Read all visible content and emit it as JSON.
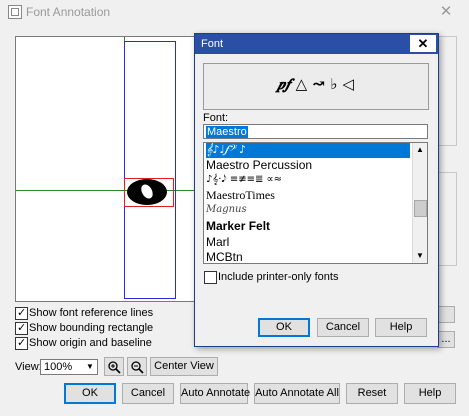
{
  "outer": {
    "title": "Font Annotation",
    "checkboxes": [
      {
        "label": "Show font reference lines",
        "checked": true
      },
      {
        "label": "Show bounding rectangle",
        "checked": true
      },
      {
        "label": "Show origin and baseline",
        "checked": true
      }
    ],
    "view_label": "View:",
    "zoom_value": "100%",
    "zoom_in_icon": "zoom-in",
    "zoom_out_icon": "zoom-out",
    "center_view": "Center View",
    "right_partial_button": "...",
    "buttons": {
      "ok": "OK",
      "cancel": "Cancel",
      "auto_annotate": "Auto Annotate",
      "auto_annotate_all": "Auto Annotate All",
      "reset": "Reset",
      "help": "Help"
    },
    "preview_glyph": "o"
  },
  "font_dialog": {
    "title": "Font",
    "close": "✕",
    "preview_text": "𝆏𝆑 △ ↝ ♭ ◁",
    "font_label": "Font:",
    "font_value": "Maestro",
    "fonts": [
      {
        "name": "𝄞♪♩𝆑𝄢 ♪",
        "selected": true,
        "style": "symbol"
      },
      {
        "name": "Maestro Percussion",
        "selected": false,
        "style": "normal"
      },
      {
        "name": "♪𝄞·𝅘𝅥𝅮 ≡≢≡≣ ∝≈",
        "selected": false,
        "style": "symbol"
      },
      {
        "name": "MaestroTimes",
        "selected": false,
        "style": "serif"
      },
      {
        "name": "Magnus",
        "selected": false,
        "style": "script"
      },
      {
        "name": "Marker Felt",
        "selected": false,
        "style": "bold"
      },
      {
        "name": "Marl",
        "selected": false,
        "style": "normal"
      },
      {
        "name": "MCBtn",
        "selected": false,
        "style": "normal"
      }
    ],
    "include_printer_only": {
      "label": "Include printer-only fonts",
      "checked": false
    },
    "buttons": {
      "ok": "OK",
      "cancel": "Cancel",
      "help": "Help"
    }
  }
}
